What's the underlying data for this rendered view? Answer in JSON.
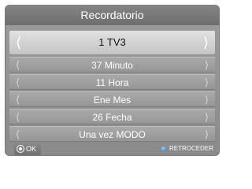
{
  "dialog": {
    "title": "Recordatorio",
    "selected": {
      "value": "1  TV3"
    },
    "rows": [
      {
        "value": "37 Minuto"
      },
      {
        "value": "11 Hora"
      },
      {
        "value": "Ene Mes"
      },
      {
        "value": "26 Fecha"
      },
      {
        "value": "Una vez MODO"
      }
    ],
    "arrows": {
      "left": "⟨",
      "right": "⟩"
    }
  },
  "footer": {
    "ok_label": "OK",
    "back_label": "RETROCEDER"
  },
  "colors": {
    "panel": "#8f8f8f",
    "title_bar": "#777777",
    "selected_row": "#d4d4d4",
    "back_dot": "#2a7bd6"
  }
}
